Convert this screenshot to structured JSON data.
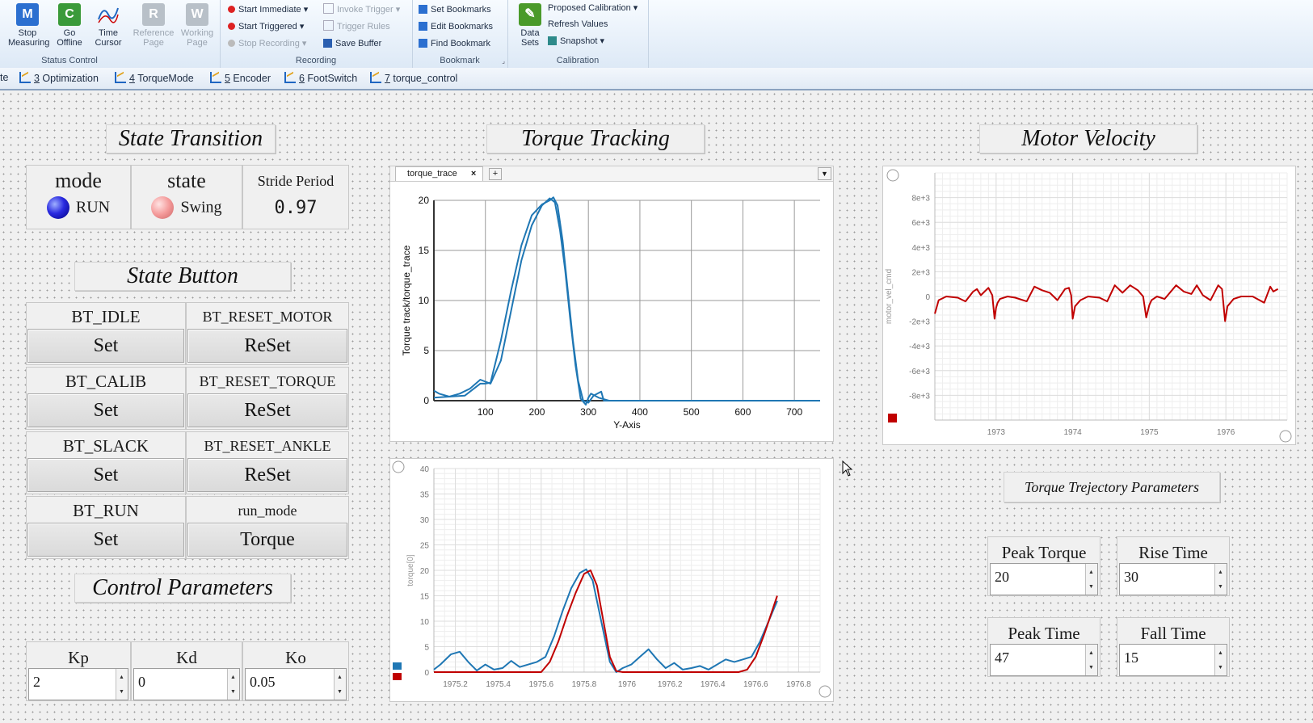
{
  "ribbon": {
    "status_control": {
      "label": "Status Control",
      "stop_measuring": "Stop\nMeasuring",
      "go_offline": "Go\nOffline",
      "time_cursor": "Time\nCursor",
      "reference_page": "Reference\nPage",
      "working_page": "Working\nPage"
    },
    "recording": {
      "label": "Recording",
      "start_immediate": "Start Immediate",
      "start_triggered": "Start Triggered",
      "stop_recording": "Stop Recording",
      "invoke_trigger": "Invoke Trigger",
      "trigger_rules": "Trigger Rules",
      "save_buffer": "Save Buffer"
    },
    "bookmark": {
      "label": "Bookmark",
      "set": "Set Bookmarks",
      "edit": "Edit Bookmarks",
      "find": "Find Bookmark"
    },
    "calibration": {
      "label": "Calibration",
      "data_sets": "Data\nSets",
      "proposed": "Proposed Calibration",
      "refresh": "Refresh Values",
      "snapshot": "Snapshot"
    },
    "colors": {
      "accent": "#1f66c1"
    }
  },
  "tabs": [
    {
      "label": "te"
    },
    {
      "num": "3",
      "label": " Optimization"
    },
    {
      "num": "4",
      "label": " TorqueMode"
    },
    {
      "num": "5",
      "label": " Encoder"
    },
    {
      "num": "6",
      "label": " FootSwitch"
    },
    {
      "num": "7",
      "label": " torque_control"
    }
  ],
  "state_transition": {
    "title": "State Transition",
    "mode_label": "mode",
    "mode_value": "RUN",
    "state_label": "state",
    "state_value": "Swing",
    "stride_label": "Stride Period",
    "stride_value": "0.97"
  },
  "state_button": {
    "title": "State Button",
    "rows": [
      {
        "left_label": "BT_IDLE",
        "left_btn": "Set",
        "right_label": "BT_RESET_MOTOR",
        "right_btn": "ReSet"
      },
      {
        "left_label": "BT_CALIB",
        "left_btn": "Set",
        "right_label": "BT_RESET_TORQUE",
        "right_btn": "ReSet"
      },
      {
        "left_label": "BT_SLACK",
        "left_btn": "Set",
        "right_label": "BT_RESET_ANKLE",
        "right_btn": "ReSet"
      },
      {
        "left_label": "BT_RUN",
        "left_btn": "Set",
        "right_label": "run_mode",
        "right_btn": "Torque"
      }
    ]
  },
  "control_params": {
    "title": "Control Parameters",
    "items": [
      {
        "label": "Kp",
        "value": "2"
      },
      {
        "label": "Kd",
        "value": "0"
      },
      {
        "label": "Ko",
        "value": "0.05"
      }
    ]
  },
  "torque_tracking": {
    "title": "Torque Tracking",
    "tab_label": "torque_trace",
    "chart_data": {
      "type": "line",
      "ylabel": "Torque track/torque_trace",
      "xlabel": "Y-Axis",
      "xlim": [
        0,
        750
      ],
      "ylim": [
        0,
        20
      ],
      "x_ticks": [
        100,
        200,
        300,
        400,
        500,
        600,
        700
      ],
      "y_ticks": [
        0,
        5,
        10,
        15,
        20
      ],
      "grid": true,
      "series": [
        {
          "color": "#1f77b4",
          "x": [
            0,
            10,
            30,
            50,
            70,
            90,
            110,
            130,
            150,
            170,
            190,
            210,
            225,
            235,
            245,
            255,
            265,
            275,
            285,
            295,
            300,
            305,
            320,
            340,
            750
          ],
          "y": [
            1,
            0.7,
            0.4,
            0.7,
            1.2,
            2.1,
            1.7,
            4,
            9,
            14,
            17.5,
            19.5,
            20.2,
            19.8,
            17,
            13,
            8,
            3.5,
            0.2,
            -0.4,
            0.3,
            0.7,
            0.3,
            0,
            0
          ]
        },
        {
          "color": "#1f77b4",
          "x": [
            0,
            60,
            90,
            100,
            110,
            130,
            150,
            170,
            190,
            210,
            225,
            232,
            240,
            250,
            260,
            270,
            280,
            290,
            300,
            310,
            325,
            330,
            750
          ],
          "y": [
            0.3,
            0.5,
            1.7,
            1.7,
            1.8,
            6,
            11,
            15.5,
            18.5,
            19.6,
            20,
            20.3,
            19.5,
            16,
            11,
            6,
            2,
            0,
            -0.2,
            0.5,
            0.9,
            0,
            0
          ]
        }
      ]
    }
  },
  "torque_time": {
    "chart_data": {
      "type": "line",
      "ylabel": "torque[0]",
      "xlim": [
        1975.1,
        1976.9
      ],
      "ylim": [
        0,
        40
      ],
      "x_ticks": [
        1975.2,
        1975.4,
        1975.6,
        1975.8,
        1976.0,
        1976.2,
        1976.4,
        1976.6,
        1976.8
      ],
      "y_ticks": [
        0,
        5,
        10,
        15,
        20,
        25,
        30,
        35,
        40
      ],
      "grid": true,
      "series": [
        {
          "color": "#1f77b4",
          "x": [
            1975.1,
            1975.13,
            1975.18,
            1975.22,
            1975.26,
            1975.3,
            1975.34,
            1975.38,
            1975.42,
            1975.46,
            1975.5,
            1975.54,
            1975.58,
            1975.62,
            1975.66,
            1975.7,
            1975.74,
            1975.78,
            1975.81,
            1975.84,
            1975.88,
            1975.92,
            1975.95,
            1975.98,
            1976.02,
            1976.06,
            1976.1,
            1976.14,
            1976.18,
            1976.22,
            1976.26,
            1976.3,
            1976.34,
            1976.38,
            1976.42,
            1976.46,
            1976.5,
            1976.54,
            1976.58,
            1976.62,
            1976.66,
            1976.7
          ],
          "y": [
            0.5,
            1.5,
            3.5,
            4,
            2,
            0.3,
            1.5,
            0.5,
            0.8,
            2.2,
            1,
            1.5,
            2,
            3,
            7,
            12,
            16.5,
            19.5,
            20.2,
            18,
            10,
            2,
            0,
            0.8,
            1.5,
            3,
            4.5,
            2.5,
            0.8,
            1.8,
            0.5,
            0.8,
            1.2,
            0.5,
            1.5,
            2.5,
            2,
            2.5,
            3,
            6,
            10,
            14
          ]
        },
        {
          "color": "#c00000",
          "x": [
            1975.1,
            1975.6,
            1975.64,
            1975.68,
            1975.72,
            1975.76,
            1975.8,
            1975.83,
            1975.86,
            1975.89,
            1975.92,
            1975.95,
            1975.98,
            1976.52,
            1976.56,
            1976.6,
            1976.64,
            1976.7
          ],
          "y": [
            0,
            0,
            2,
            6,
            11,
            15.5,
            19.3,
            20,
            17,
            10,
            3,
            0.2,
            0,
            0,
            0.5,
            3,
            7.5,
            15
          ]
        }
      ]
    }
  },
  "motor_velocity": {
    "title": "Motor Velocity",
    "chart_data": {
      "type": "line",
      "ylabel": "motor_vel_cmd",
      "xlim": [
        1972.2,
        1976.8
      ],
      "ylim": [
        -10000,
        10000
      ],
      "x_ticks": [
        1973,
        1974,
        1975,
        1976
      ],
      "y_ticks": [
        -8000,
        -6000,
        -4000,
        -2000,
        0,
        2000,
        4000,
        6000,
        8000
      ],
      "y_tick_labels": [
        "-8e+3",
        "-6e+3",
        "-4e+3",
        "-2e+3",
        "0",
        "2e+3",
        "4e+3",
        "6e+3",
        "8e+3"
      ],
      "grid": true,
      "series": [
        {
          "color": "#c00000",
          "x": [
            1972.2,
            1972.25,
            1972.35,
            1972.5,
            1972.6,
            1972.7,
            1972.75,
            1972.8,
            1972.85,
            1972.9,
            1972.95,
            1972.98,
            1973.0,
            1973.02,
            1973.05,
            1973.15,
            1973.25,
            1973.4,
            1973.5,
            1973.6,
            1973.7,
            1973.8,
            1973.9,
            1973.95,
            1973.98,
            1974.0,
            1974.03,
            1974.1,
            1974.2,
            1974.35,
            1974.45,
            1974.55,
            1974.65,
            1974.75,
            1974.85,
            1974.92,
            1974.96,
            1975.0,
            1975.03,
            1975.1,
            1975.2,
            1975.35,
            1975.45,
            1975.55,
            1975.62,
            1975.7,
            1975.8,
            1975.9,
            1975.95,
            1975.99,
            1976.02,
            1976.1,
            1976.2,
            1976.35,
            1976.5,
            1976.58,
            1976.62,
            1976.68
          ],
          "y": [
            -1400,
            -300,
            0,
            -100,
            -400,
            400,
            600,
            100,
            400,
            700,
            100,
            -1800,
            -900,
            -500,
            -200,
            0,
            -100,
            -400,
            800,
            500,
            300,
            -300,
            600,
            700,
            100,
            -1800,
            -800,
            -300,
            0,
            -100,
            -400,
            900,
            300,
            900,
            500,
            0,
            -1700,
            -700,
            -300,
            0,
            -200,
            900,
            400,
            200,
            900,
            100,
            -300,
            900,
            600,
            -2000,
            -800,
            -200,
            0,
            0,
            -500,
            800,
            400,
            600
          ]
        }
      ]
    }
  },
  "torque_params": {
    "title": "Torque Trejectory Parameters",
    "items": [
      {
        "label": "Peak Torque",
        "value": "20"
      },
      {
        "label": "Rise Time",
        "value": "30"
      },
      {
        "label": "Peak Time",
        "value": "47"
      },
      {
        "label": "Fall Time",
        "value": "15"
      }
    ]
  }
}
